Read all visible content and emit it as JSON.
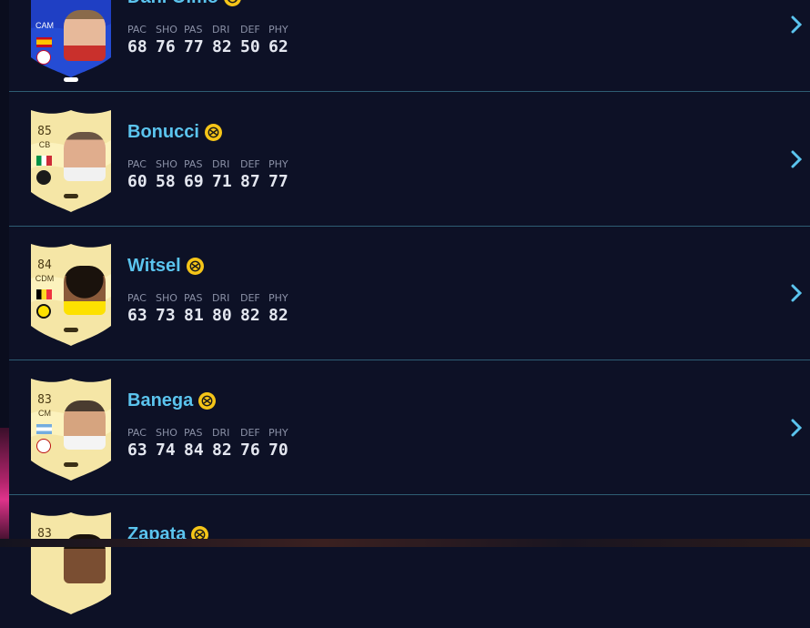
{
  "stat_labels": [
    "PAC",
    "SHO",
    "PAS",
    "DRI",
    "DEF",
    "PHY"
  ],
  "colors": {
    "background": "#0d1126",
    "divider": "#2e5d73",
    "name": "#5bc4ee",
    "chemistry_badge": "#f5c518",
    "stat_value": "#e3e6ef",
    "stat_label": "#8a90a6",
    "chevron": "#5bc4ee",
    "gold_card": "#f5e6a6",
    "blue_card": "#1f3fc4"
  },
  "players": [
    {
      "name": "Dani Olmo",
      "rating": "",
      "position": "CAM",
      "card_style": "blue",
      "flag_icon": "spain-flag-icon",
      "club_icon": "rb-leipzig-crest-icon",
      "stats": [
        "68",
        "76",
        "77",
        "82",
        "50",
        "62"
      ]
    },
    {
      "name": "Bonucci",
      "rating": "85",
      "position": "CB",
      "card_style": "gold",
      "flag_icon": "italy-flag-icon",
      "club_icon": "juventus-crest-icon",
      "stats": [
        "60",
        "58",
        "69",
        "71",
        "87",
        "77"
      ]
    },
    {
      "name": "Witsel",
      "rating": "84",
      "position": "CDM",
      "card_style": "gold",
      "flag_icon": "belgium-flag-icon",
      "club_icon": "bvb-crest-icon",
      "stats": [
        "63",
        "73",
        "81",
        "80",
        "82",
        "82"
      ]
    },
    {
      "name": "Banega",
      "rating": "83",
      "position": "CM",
      "card_style": "gold",
      "flag_icon": "argentina-flag-icon",
      "club_icon": "al-shabab-crest-icon",
      "stats": [
        "63",
        "74",
        "84",
        "82",
        "76",
        "70"
      ]
    },
    {
      "name": "Zapata",
      "rating": "83",
      "position": "",
      "card_style": "gold",
      "flag_icon": "colombia-flag-icon",
      "club_icon": "club-crest-icon",
      "stats": [
        "",
        "",
        "",
        "",
        "",
        ""
      ]
    }
  ]
}
